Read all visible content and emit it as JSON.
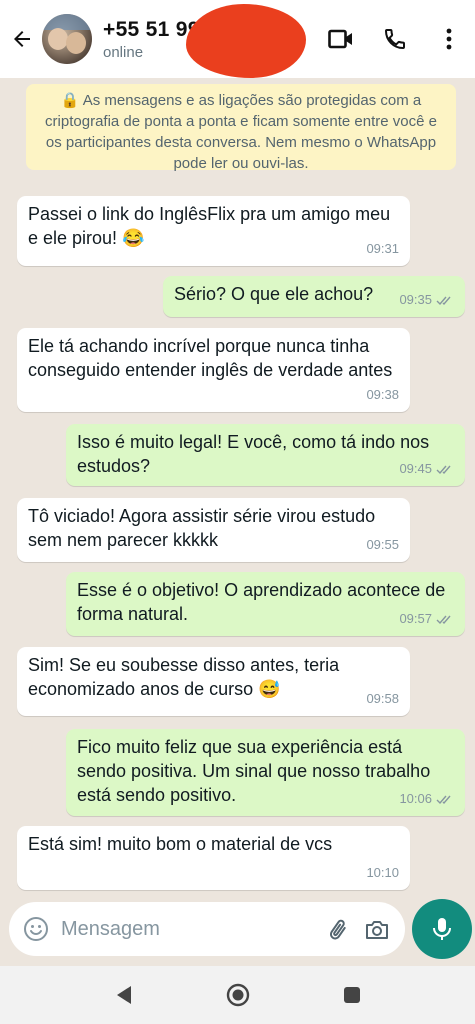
{
  "header": {
    "contact_name": "+55 51 995",
    "status": "online"
  },
  "encryption_notice": "🔒 As mensagens e as ligações são protegidas com a criptografia de ponta a ponta e ficam somente entre você e os participantes desta conversa. Nem mesmo o WhatsApp pode ler ou ouvi-las.",
  "messages": [
    {
      "dir": "in",
      "text": "Passei o link do InglêsFlix pra um amigo meu e ele pirou! 😂",
      "time": "09:31"
    },
    {
      "dir": "out",
      "text": "Sério? O que ele achou?",
      "time": "09:35"
    },
    {
      "dir": "in",
      "text": "Ele tá achando incrível porque nunca tinha conseguido entender inglês de verdade antes",
      "time": "09:38"
    },
    {
      "dir": "out",
      "text": "Isso é muito legal! E você, como tá indo nos estudos?",
      "time": "09:45"
    },
    {
      "dir": "in",
      "text": "Tô viciado! Agora assistir série virou estudo sem nem parecer kkkkk",
      "time": "09:55"
    },
    {
      "dir": "out",
      "text": "Esse é o objetivo! O aprendizado acontece de forma natural.",
      "time": "09:57"
    },
    {
      "dir": "in",
      "text": "Sim! Se eu soubesse disso antes, teria economizado anos de curso 😅",
      "time": "09:58"
    },
    {
      "dir": "out",
      "text": "Fico muito feliz que sua experiência está sendo positiva. Um sinal que nosso trabalho está sendo positivo.",
      "time": "10:06"
    },
    {
      "dir": "in",
      "text": "Está sim! muito bom o material de vcs",
      "time": "10:10"
    }
  ],
  "input": {
    "placeholder": "Mensagem"
  },
  "colors": {
    "accent": "#128c7e",
    "outgoing_bubble": "#dcf8c6",
    "encryption_bg": "#fdf4c5",
    "chat_bg": "#ece5dd"
  },
  "icons": [
    "back-arrow-icon",
    "video-call-icon",
    "phone-icon",
    "more-vert-icon",
    "emoji-icon",
    "attach-icon",
    "camera-icon",
    "mic-icon",
    "nav-back-icon",
    "nav-home-icon",
    "nav-recents-icon"
  ]
}
